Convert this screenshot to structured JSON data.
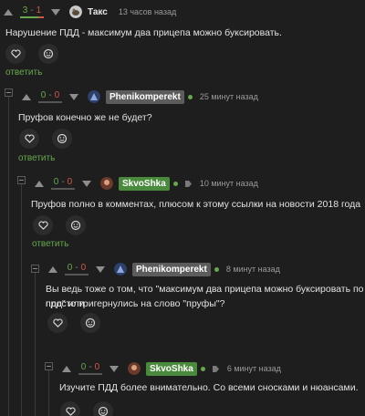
{
  "colors": {
    "background": "#1e1e1e",
    "accent_green": "#66a84c",
    "minus_red": "#d0574b"
  },
  "comments": [
    {
      "rating_plus": "3",
      "rating_minus": "1",
      "rating_plus_share": 0.75,
      "author": "Такс",
      "author_style": "plain",
      "time": "13 часов назад",
      "text": "Нарушение ПДД - максимум два прицепа можно буксировать.",
      "reply": "ответить",
      "icons": [
        "heart-icon",
        "emoji-icon"
      ]
    },
    {
      "rating_plus": "0",
      "rating_minus": "0",
      "author": "Phenikomperekt",
      "author_style": "gray-tag",
      "time": "25 минут назад",
      "text": "Пруфов конечно же не будет?",
      "reply": "ответить"
    },
    {
      "rating_plus": "0",
      "rating_minus": "0",
      "author": "SkvoShka",
      "author_style": "green-tag",
      "time": "10 минут назад",
      "text": "Пруфов полно в комментах, плюсом к этому ссылки на новости 2018 года",
      "reply": "ответить"
    },
    {
      "rating_plus": "0",
      "rating_minus": "0",
      "author": "Phenikomperekt",
      "author_style": "gray-tag",
      "time": "8 минут назад",
      "text_line1": "Вы ведь тоже о том, что \"максимум два прицепа можно буксировать по пдд\" или",
      "text_line2": "просто тригернулись на слово \"пруфы\"?"
    },
    {
      "rating_plus": "0",
      "rating_minus": "0",
      "author": "SkvoShka",
      "author_style": "green-tag",
      "time": "6 минут назад",
      "text": "Изучите ПДД более внимательно. Со всеми сносками и нюансами."
    }
  ]
}
